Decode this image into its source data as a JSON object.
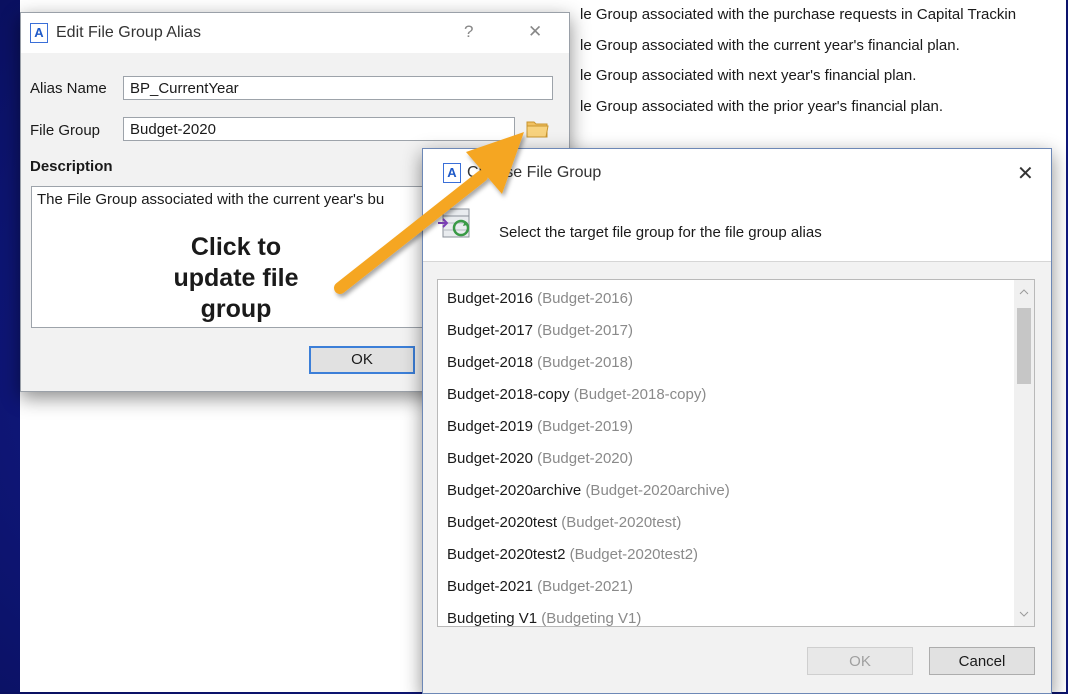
{
  "background_window": {
    "lines": [
      "le Group associated with the purchase requests in Capital Trackin",
      "le Group associated with the current year's financial plan.",
      "le Group associated with next year's financial plan.",
      "le Group associated with the prior year's financial plan."
    ]
  },
  "edit_dialog": {
    "title": "Edit File Group Alias",
    "app_icon_letter": "A",
    "help_glyph": "?",
    "close_glyph": "✕",
    "alias_name_label": "Alias Name",
    "alias_name_value": "BP_CurrentYear",
    "file_group_label": "File Group",
    "file_group_value": "Budget-2020",
    "description_label": "Description",
    "description_value": "The File Group associated with the current year's bu",
    "ok_label": "OK"
  },
  "annotation": {
    "lines": [
      "Click to",
      "update file",
      "group"
    ],
    "arrow_color": "#f5a623"
  },
  "choose_dialog": {
    "title": "Choose File Group",
    "app_icon_letter": "A",
    "close_glyph": "✕",
    "instruction": "Select the target file group for the file group alias",
    "items": [
      {
        "name": "Budget-2016",
        "alt": "(Budget-2016)"
      },
      {
        "name": "Budget-2017",
        "alt": "(Budget-2017)"
      },
      {
        "name": "Budget-2018",
        "alt": "(Budget-2018)"
      },
      {
        "name": "Budget-2018-copy",
        "alt": "(Budget-2018-copy)"
      },
      {
        "name": "Budget-2019",
        "alt": "(Budget-2019)"
      },
      {
        "name": "Budget-2020",
        "alt": "(Budget-2020)"
      },
      {
        "name": "Budget-2020archive",
        "alt": "(Budget-2020archive)"
      },
      {
        "name": "Budget-2020test",
        "alt": "(Budget-2020test)"
      },
      {
        "name": "Budget-2020test2",
        "alt": "(Budget-2020test2)"
      },
      {
        "name": "Budget-2021",
        "alt": "(Budget-2021)"
      },
      {
        "name": "Budgeting V1",
        "alt": "(Budgeting V1)"
      }
    ],
    "ok_label": "OK",
    "cancel_label": "Cancel"
  },
  "colors": {
    "accent": "#3c7fd8",
    "background": "#111a86"
  }
}
